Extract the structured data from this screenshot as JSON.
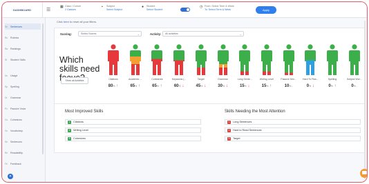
{
  "topbar": {
    "brand": "DASHBOARD",
    "filters": [
      {
        "label": "Class / Cohort",
        "value": "2 Classes"
      },
      {
        "label": "Subject",
        "value": "Select Subject"
      },
      {
        "label": "Student",
        "value": "Select Student"
      },
      {
        "label": "From: Select Term & Week",
        "value": "To: Select Term & Week"
      }
    ],
    "apply_label": "Apply"
  },
  "sidebar": {
    "items": [
      {
        "abbr": "Se",
        "label": "Sentences"
      },
      {
        "abbr": "Ru",
        "label": "Rubrics"
      },
      {
        "abbr": "Ra",
        "label": "Rankings"
      },
      {
        "abbr": "St",
        "label": "Student Skills"
      },
      {
        "abbr": "Us",
        "label": "Usage"
      },
      {
        "abbr": "Sp",
        "label": "Spelling"
      },
      {
        "abbr": "Gr",
        "label": "Grammar"
      },
      {
        "abbr": "Pv",
        "label": "Passive Voice"
      },
      {
        "abbr": "Co",
        "label": "Cohesives"
      },
      {
        "abbr": "Vo",
        "label": "Vocabulary"
      },
      {
        "abbr": "Se",
        "label": "Sentences"
      },
      {
        "abbr": "Re",
        "label": "Readability"
      },
      {
        "abbr": "Fe",
        "label": "Feedback"
      }
    ],
    "footer_icon": "accessibility-icon"
  },
  "main": {
    "reset_text": "Click ",
    "reset_link": "here",
    "reset_rest": " to reset all your filters.",
    "scoring_label": "Scoring:",
    "scoring_value": "Scribo Scores",
    "activity_label": "Activity:",
    "activity_value": "All activities",
    "heading": "Which skills need focus?",
    "all_activities_button": "Show all Activities",
    "caption": "Percentage of students in the lowest 2 quarters (50% or less)",
    "skills": [
      {
        "name": "Citations",
        "pct": "80",
        "trend": "up",
        "mix": {
          "red": 1.0,
          "orange": 0.0,
          "green": 0.0
        }
      },
      {
        "name": "Academic ...",
        "pct": "65",
        "trend": "up",
        "mix": {
          "red": 0.45,
          "orange": 0.3,
          "green": 0.25
        }
      },
      {
        "name": "Cohesives",
        "pct": "65",
        "trend": "up",
        "mix": {
          "red": 0.65,
          "orange": 0.0,
          "green": 0.35
        }
      },
      {
        "name": "Keywords (...",
        "pct": "60",
        "trend": "down",
        "mix": {
          "red": 0.6,
          "orange": 0.0,
          "green": 0.4
        }
      },
      {
        "name": "Target",
        "pct": "45",
        "trend": "down",
        "mix": {
          "red": 0.3,
          "orange": 0.0,
          "green": 0.7
        }
      },
      {
        "name": "Grammar",
        "pct": "30",
        "trend": "down",
        "mix": {
          "red": 0.3,
          "orange": 0.15,
          "green": 0.55
        }
      },
      {
        "name": "Long Sente...",
        "pct": "15",
        "trend": "down",
        "mix": {
          "red": 0.15,
          "orange": 0.0,
          "green": 0.85
        }
      },
      {
        "name": "Writing Level",
        "pct": "15",
        "trend": "up",
        "mix": {
          "red": 0.15,
          "orange": 0.0,
          "green": 0.85
        }
      },
      {
        "name": "Passive Sen...",
        "pct": "10",
        "trend": "none",
        "mix": {
          "red": 0.1,
          "orange": 0.0,
          "green": 0.9
        }
      },
      {
        "name": "Hard To Rea...",
        "pct": "0",
        "trend": "down",
        "mix": {
          "red": 0.0,
          "orange": 0.0,
          "green": 0.4,
          "blue": 0.6
        }
      },
      {
        "name": "Spelling",
        "pct": "0",
        "trend": "up",
        "mix": {
          "red": 0.0,
          "orange": 0.0,
          "green": 1.0
        }
      },
      {
        "name": "Subject Wor...",
        "pct": "0",
        "trend": "none",
        "mix": {
          "red": 0.0,
          "orange": 0.0,
          "green": 1.0
        }
      }
    ],
    "most_improved_title": "Most Improved Skills",
    "most_improved": [
      "Citations",
      "Writing Level",
      "Cohesives"
    ],
    "needs_attention_title": "Skills Needing the Most Attention",
    "needs_attention": [
      "Long Sentences",
      "Hard to Read Sentences",
      "Target"
    ],
    "colors": {
      "red": "#e5393c",
      "orange": "#f4a032",
      "green": "#3cae4a",
      "blue": "#2f9fe0",
      "accent": "#2f80ed"
    }
  }
}
